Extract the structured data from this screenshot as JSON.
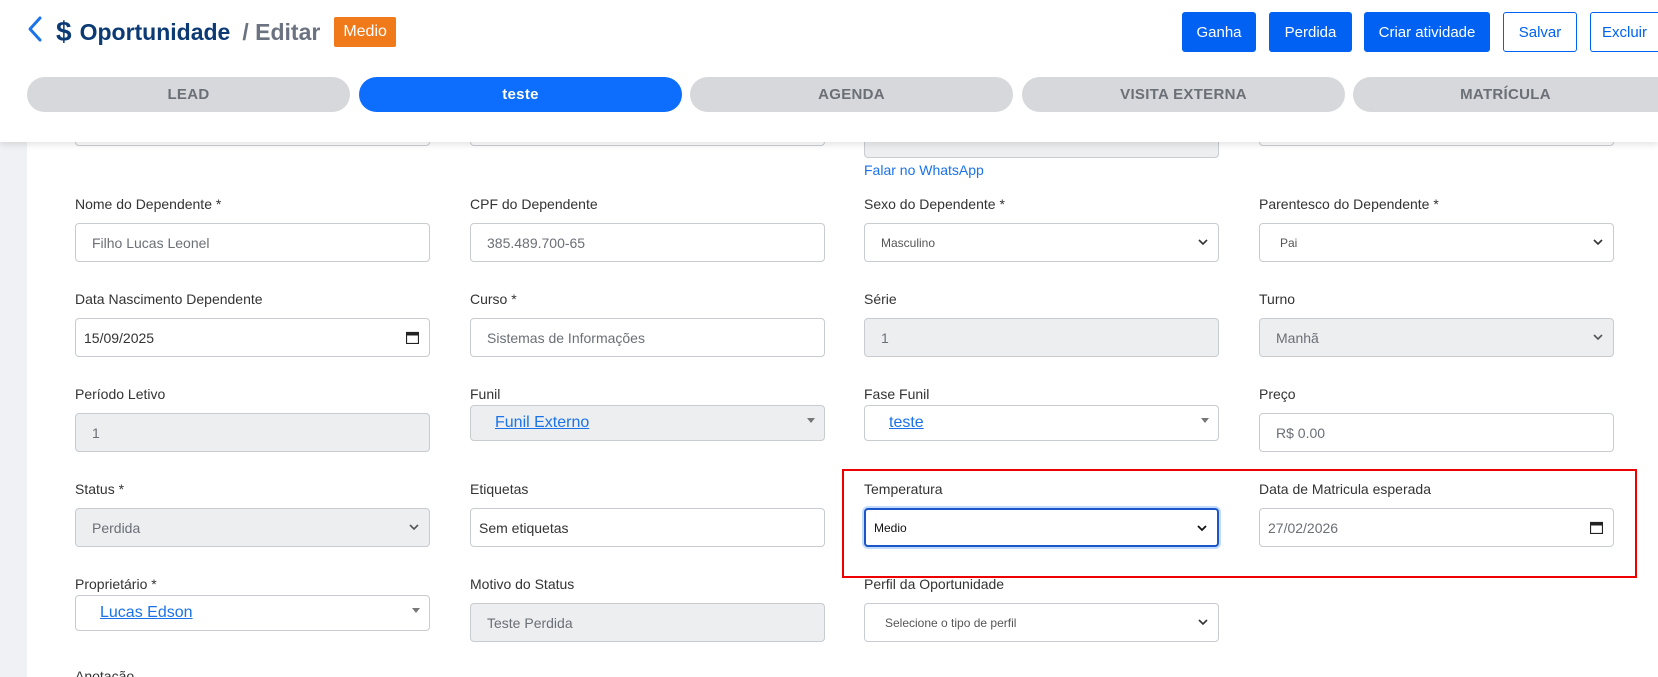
{
  "header": {
    "title": "Oportunidade",
    "subtitle": "/ Editar",
    "temperature_badge": "Medio",
    "buttons": {
      "won": "Ganha",
      "lost": "Perdida",
      "create_activity": "Criar atividade",
      "save": "Salvar",
      "delete": "Excluir"
    }
  },
  "stages": [
    "LEAD",
    "teste",
    "AGENDA",
    "VISITA EXTERNA",
    "MATRÍCULA"
  ],
  "active_stage": "teste",
  "whatsapp_link": "Falar no WhatsApp",
  "fields": {
    "dependent_name": {
      "label": "Nome do Dependente  *",
      "value": "Filho Lucas Leonel"
    },
    "dependent_cpf": {
      "label": "CPF do Dependente",
      "value": "385.489.700-65"
    },
    "dependent_sex": {
      "label": "Sexo do Dependente  *",
      "value": "Masculino"
    },
    "dependent_relation": {
      "label": "Parentesco do Dependente *",
      "value": "Pai"
    },
    "dependent_birth": {
      "label": "Data Nascimento Dependente",
      "value": "15/09/2025"
    },
    "course": {
      "label": "Curso *",
      "value": "Sistemas de Informações"
    },
    "grade": {
      "label": "Série",
      "value": "1"
    },
    "shift": {
      "label": "Turno",
      "value": "Manhã"
    },
    "school_period": {
      "label": "Período Letivo",
      "value": "1"
    },
    "funnel": {
      "label": "Funil",
      "value": "Funil Externo"
    },
    "funnel_stage": {
      "label": "Fase Funil",
      "value": "teste"
    },
    "price": {
      "label": "Preço",
      "placeholder": "R$ 0.00"
    },
    "status": {
      "label": "Status *",
      "value": "Perdida"
    },
    "tags": {
      "label": "Etiquetas",
      "value": "Sem etiquetas"
    },
    "temperature": {
      "label": "Temperatura",
      "value": "Medio"
    },
    "expected_enrollment": {
      "label": "Data de Matricula esperada",
      "value": "27/02/2026"
    },
    "owner": {
      "label": "Proprietário *",
      "value": "Lucas Edson"
    },
    "status_reason": {
      "label": "Motivo do Status",
      "value": "Teste Perdida"
    },
    "profile": {
      "label": "Perfil da Oportunidade",
      "value": "Selecione o tipo de perfil"
    },
    "annotation": {
      "label": "Anotação"
    }
  },
  "colors": {
    "primary": "#0061f2",
    "active_stage": "#0d6efd",
    "inactive_stage": "#d7d8db",
    "badge": "#f07a1a",
    "highlight": "#e00000"
  }
}
